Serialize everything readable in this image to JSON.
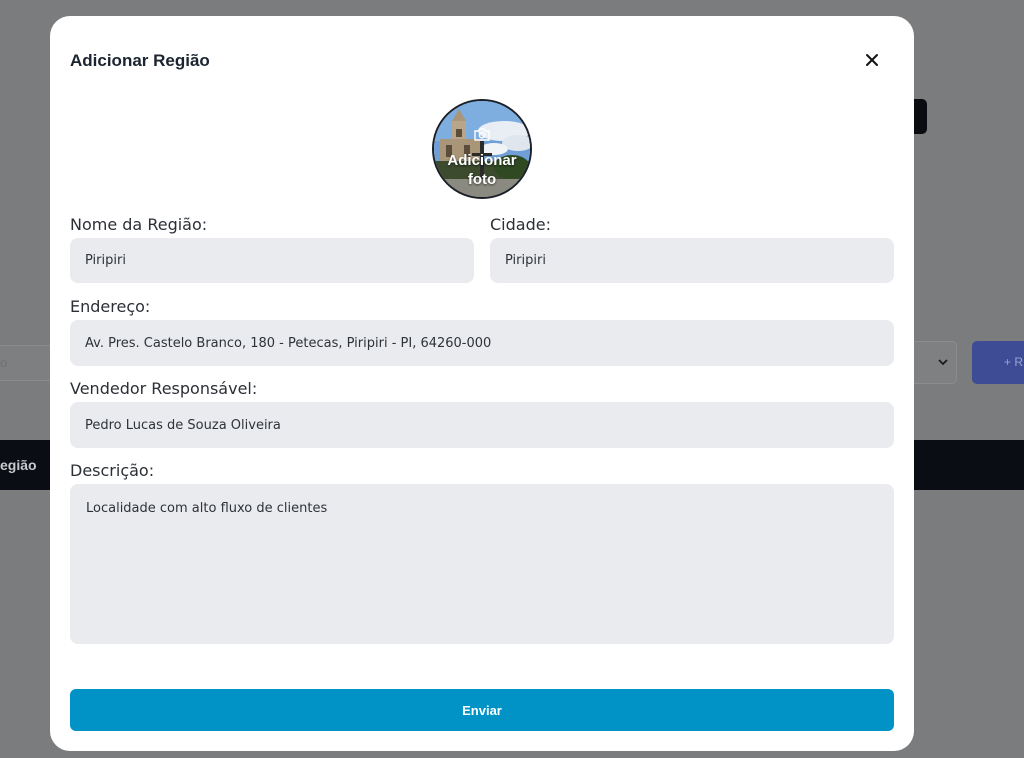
{
  "background": {
    "left_fragment": "o",
    "blue_button_fragment": "+ R",
    "bar_fragment": "egião"
  },
  "modal": {
    "title": "Adicionar Região",
    "photo_label_line1": "Adicionar",
    "photo_label_line2": "foto",
    "fields": {
      "nome_label": "Nome da Região:",
      "nome_value": "Piripiri",
      "cidade_label": "Cidade:",
      "cidade_value": "Piripiri",
      "endereco_label": "Endereço:",
      "endereco_value": "Av. Pres. Castelo Branco, 180 - Petecas, Piripiri - PI, 64260-000",
      "vendedor_label": "Vendedor Responsável:",
      "vendedor_value": "Pedro Lucas de Souza Oliveira",
      "descricao_label": "Descrição:",
      "descricao_value": "Localidade com alto fluxo de clientes"
    },
    "submit_label": "Enviar"
  },
  "colors": {
    "overlay": "#7b7c7e",
    "field_bg": "#eaebef",
    "submit_bg": "#0293c6",
    "title": "#1b2430"
  },
  "icons": [
    "close-icon",
    "camera-icon",
    "chevron-down-icon"
  ]
}
